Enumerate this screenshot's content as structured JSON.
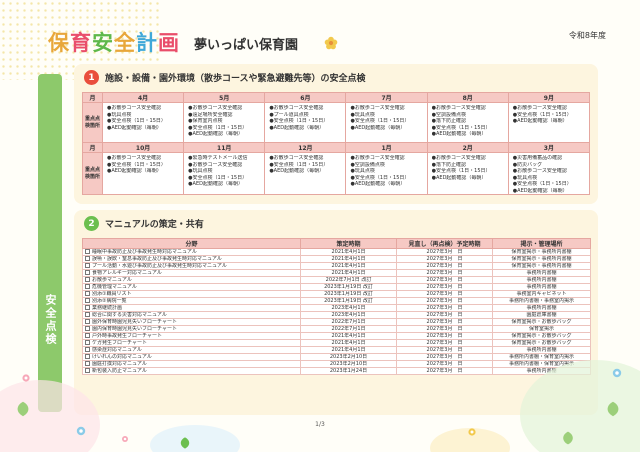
{
  "header": {
    "title_chars": [
      {
        "ch": "保",
        "color": "#e8a73a"
      },
      {
        "ch": "育",
        "color": "#e94e6a"
      },
      {
        "ch": "安",
        "color": "#5fb84a"
      },
      {
        "ch": "全",
        "color": "#e8a73a"
      },
      {
        "ch": "計",
        "color": "#3fa8d8"
      },
      {
        "ch": "画",
        "color": "#e94e6a"
      }
    ],
    "subtitle": "夢いっぱい保育園",
    "era": "令和8年度"
  },
  "sidebar": {
    "label": "安全点検"
  },
  "section1": {
    "number": "1",
    "title": "施設・設備・園外環境（散歩コースや緊急避難先等）の安全点検",
    "month_label": "月",
    "row_label": "重点点検箇所",
    "rows": [
      {
        "months": [
          "4月",
          "5月",
          "6月",
          "7月",
          "8月",
          "9月"
        ],
        "cells": [
          [
            "●お散歩コース安全確認",
            "●玩具点検",
            "●安全点検（1日・15日）",
            "●AED起動確認（毎朝）"
          ],
          [
            "●お散歩コース安全確認",
            "●遠足場所安全確認",
            "●保育室内点検",
            "●安全点検（1日・15日）",
            "●AED起動確認（毎朝）"
          ],
          [
            "●お散歩コース安全確認",
            "●プール道具点検",
            "●安全点検（1日・15日）",
            "●AED起動確認（毎朝）"
          ],
          [
            "●お散歩コース安全確認",
            "●玩具点検",
            "●安全点検（1日・15日）",
            "●AED起動確認（毎朝）"
          ],
          [
            "●お散歩コース安全確認",
            "●空調設備点検",
            "●落下防止確認",
            "●安全点検（1日・15日）",
            "●AED起動確認（毎朝）"
          ],
          [
            "●お散歩コース安全確認",
            "●安全点検（1日・15日）",
            "●AED起動確認（毎朝）"
          ]
        ]
      },
      {
        "months": [
          "10月",
          "11月",
          "12月",
          "1月",
          "2月",
          "3月"
        ],
        "cells": [
          [
            "●お散歩コース安全確認",
            "●安全点検（1日・15日）",
            "●AED起動確認（毎朝）"
          ],
          [
            "●緊急時テストメール送信",
            "●お散歩コース安全確認",
            "●玩具点検",
            "●安全点検（1日・15日）",
            "●AED起動確認（毎朝）"
          ],
          [
            "●お散歩コース安全確認",
            "●安全点検（1日・15日）",
            "●AED起動確認（毎朝）"
          ],
          [
            "●お散歩コース安全確認",
            "●空調設備点検",
            "●玩具点検",
            "●安全点検（1日・15日）",
            "●AED起動確認（毎朝）"
          ],
          [
            "●お散歩コース安全確認",
            "●落下防止確認",
            "●安全点検（1日・15日）",
            "●AED起動確認（毎朝）"
          ],
          [
            "●災害用備蓄品の確認",
            "●防災バッグ",
            "●お散歩コース安全確認",
            "●玩具点検",
            "●安全点検（1日・15日）",
            "●AED起動確認（毎朝）"
          ]
        ]
      }
    ]
  },
  "section2": {
    "number": "2",
    "title": "マニュアルの策定・共有",
    "headers": [
      "分野",
      "策定時期",
      "見直し（再点検）予定時期",
      "掲示・管理場所"
    ],
    "rows": [
      [
        "睡眠中事故防止及び事故発生時対応マニュアル",
        "2021年4月1日",
        "2027年3月　日",
        "保育室掲示・事務所内書棚"
      ],
      [
        "誤嚥・誤飲・窒息事故防止及び事故発生時対応マニュアル",
        "2021年4月1日",
        "2027年3月　日",
        "保育室掲示・事務所内書棚"
      ],
      [
        "プール活動・水遊び事故防止及び事故発生時対応マニュアル",
        "2021年4月1日",
        "2027年3月　日",
        "保育室掲示・事務所内書棚"
      ],
      [
        "食物アレルギー対応マニュアル",
        "2021年4月1日",
        "2027年3月　日",
        "事務所内書棚"
      ],
      [
        "お散歩マニュアル",
        "2022年7月1日 改訂",
        "2027年3月　日",
        "事務所内書棚"
      ],
      [
        "危機管理マニュアル",
        "2023年1月19日 改訂",
        "2027年3月　日",
        "事務所内書棚"
      ],
      [
        "別添①職員リスト",
        "2023年1月19日 改訂",
        "2027年3月　日",
        "事務室内キャビネット"
      ],
      [
        "別添②病院一覧",
        "2023年1月19日 改訂",
        "2027年3月　日",
        "事務所内書棚・事務室内掲示"
      ],
      [
        "業務継続計画",
        "2023年4月1日",
        "2027年3月　日",
        "事務所内書棚"
      ],
      [
        "総合に関する災害対応マニュアル",
        "2023年4月1日",
        "2027年3月　日",
        "園庭倉庫書棚"
      ],
      [
        "園外保育時園児見失いフローチャート",
        "2022年7月1日",
        "2027年3月　日",
        "保育室掲示・お散歩バッグ"
      ],
      [
        "園内保育時園児見失いフローチャート",
        "2022年7月1日",
        "2027年3月　日",
        "保育室掲示"
      ],
      [
        "戸外時事故発生フローチャート",
        "2021年4月1日",
        "2027年3月　日",
        "保育室掲示・お散歩バッグ"
      ],
      [
        "ケガ発生フローチャート",
        "2021年4月1日",
        "2027年3月　日",
        "保育室掲示・お散歩バッグ"
      ],
      [
        "感染症対応マニュアル",
        "2021年4月1日",
        "2027年3月　日",
        "事務所内書棚"
      ],
      [
        "けいれんの対応マニュアル",
        "2023年2月10日",
        "2027年3月　日",
        "事務所内書棚・保育室内掲示"
      ],
      [
        "園庭打撲対応マニュアル",
        "2023年2月10日",
        "2027年3月　日",
        "事務所内書棚・保育室内掲示"
      ],
      [
        "新包装入防止マニュアル",
        "2023年1月24日",
        "2027年3月　日",
        "事務所内書棚"
      ]
    ]
  },
  "footer": {
    "page": "1/3"
  },
  "colors": {
    "sidebar": "#8dc96b",
    "section_bg": "#fdf5df",
    "table_header": "#f6c9c4",
    "number1": "#e94e3d",
    "number2": "#6cbf4f"
  }
}
